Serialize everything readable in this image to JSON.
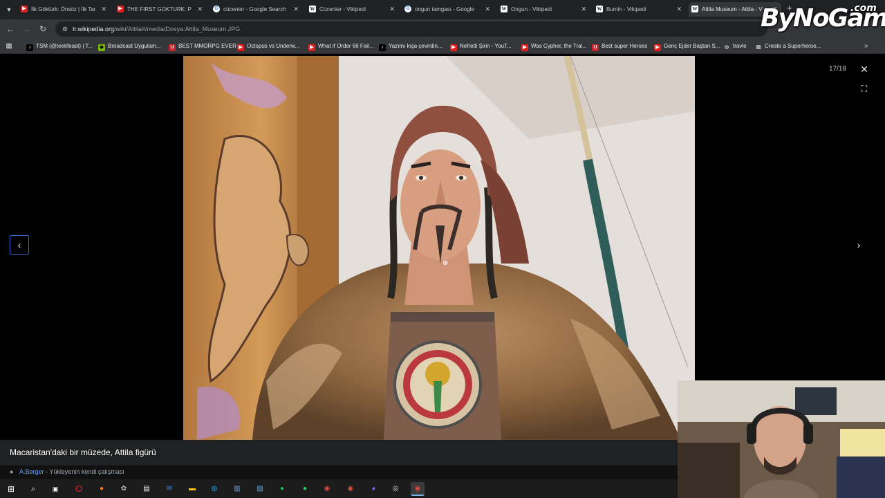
{
  "browser": {
    "tabs": [
      {
        "label": "İlk Göktürk: Önsöz | İlk Tar",
        "favicon": "youtube"
      },
      {
        "label": "THE FIRST GOKTURK: Pro",
        "favicon": "youtube"
      },
      {
        "label": "cücenler - Google Search",
        "favicon": "google"
      },
      {
        "label": "Cücenler - Vikipedi",
        "favicon": "wikipedia"
      },
      {
        "label": "ongun tamgası - Google",
        "favicon": "google"
      },
      {
        "label": "Ongun - Vikipedi",
        "favicon": "wikipedia"
      },
      {
        "label": "Bumin - Vikipedi",
        "favicon": "wikipedia"
      },
      {
        "label": "Attila Museum - Attila - V",
        "favicon": "wikipedia",
        "active": true
      }
    ],
    "url_host": "tr.wikipedia.org",
    "url_path": "/wiki/Attila#/media/Dosya:Attila_Museum.JPG",
    "bookmarks": [
      {
        "label": "TSM (@teekfeast) | T...",
        "icon": "tiktok"
      },
      {
        "label": "Broadcast Uygulam...",
        "icon": "nvidia"
      },
      {
        "label": "BEST MMORPG EVER",
        "icon": "ultimate"
      },
      {
        "label": "Octopus vs Underw...",
        "icon": "youtube"
      },
      {
        "label": "What if Order 66 Fail...",
        "icon": "youtube"
      },
      {
        "label": "Yazımı kışa çevirdin...",
        "icon": "tiktok"
      },
      {
        "label": "Nefretli Şirin - YouT...",
        "icon": "youtube"
      },
      {
        "label": "Was Cypher, the Trai...",
        "icon": "youtube"
      },
      {
        "label": "Best super Heroes",
        "icon": "ultimate"
      },
      {
        "label": "Genç Ejder Baştan S...",
        "icon": "youtube"
      },
      {
        "label": "travle",
        "icon": "compass"
      },
      {
        "label": "Create a Superheroe...",
        "icon": "doc"
      }
    ]
  },
  "viewer": {
    "counter": "17/18",
    "caption": "Macaristan'daki bir müzede, Attila figürü",
    "author": "A.Berger",
    "credit_rest": " - Yükleyenin kendi çalışması"
  },
  "watermark": {
    "main": "ByNoGame",
    "suffix": ".com"
  },
  "icons": {
    "back": "back-arrow-icon",
    "forward": "forward-arrow-icon",
    "reload": "reload-icon",
    "close": "close-icon",
    "fullscreen": "fullscreen-icon",
    "prev": "chevron-left-icon",
    "next": "chevron-right-icon"
  },
  "colors": {
    "tab_bg": "#202124",
    "toolbar_bg": "#35363a",
    "link_blue": "#6b9eff",
    "focus_outline": "#3366cc"
  }
}
